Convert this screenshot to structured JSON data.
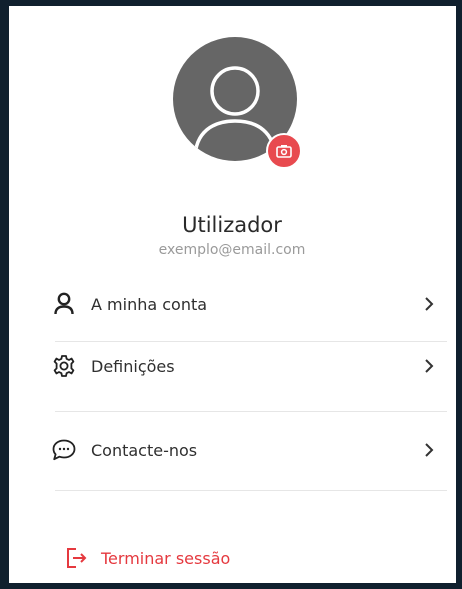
{
  "profile": {
    "name": "Utilizador",
    "email": "exemplo@email.com",
    "avatar_icon": "user-avatar-icon",
    "change_photo_icon": "camera-icon"
  },
  "menu": {
    "items": [
      {
        "label": "A minha conta",
        "icon": "person-icon"
      },
      {
        "label": "Definições",
        "icon": "gear-icon"
      },
      {
        "label": "Contacte-nos",
        "icon": "chat-bubble-icon"
      }
    ],
    "logout_label": "Terminar sessão",
    "logout_icon": "logout-icon"
  },
  "colors": {
    "accent": "#e5393f",
    "avatar_bg": "#666666",
    "frame": "#10202e"
  }
}
